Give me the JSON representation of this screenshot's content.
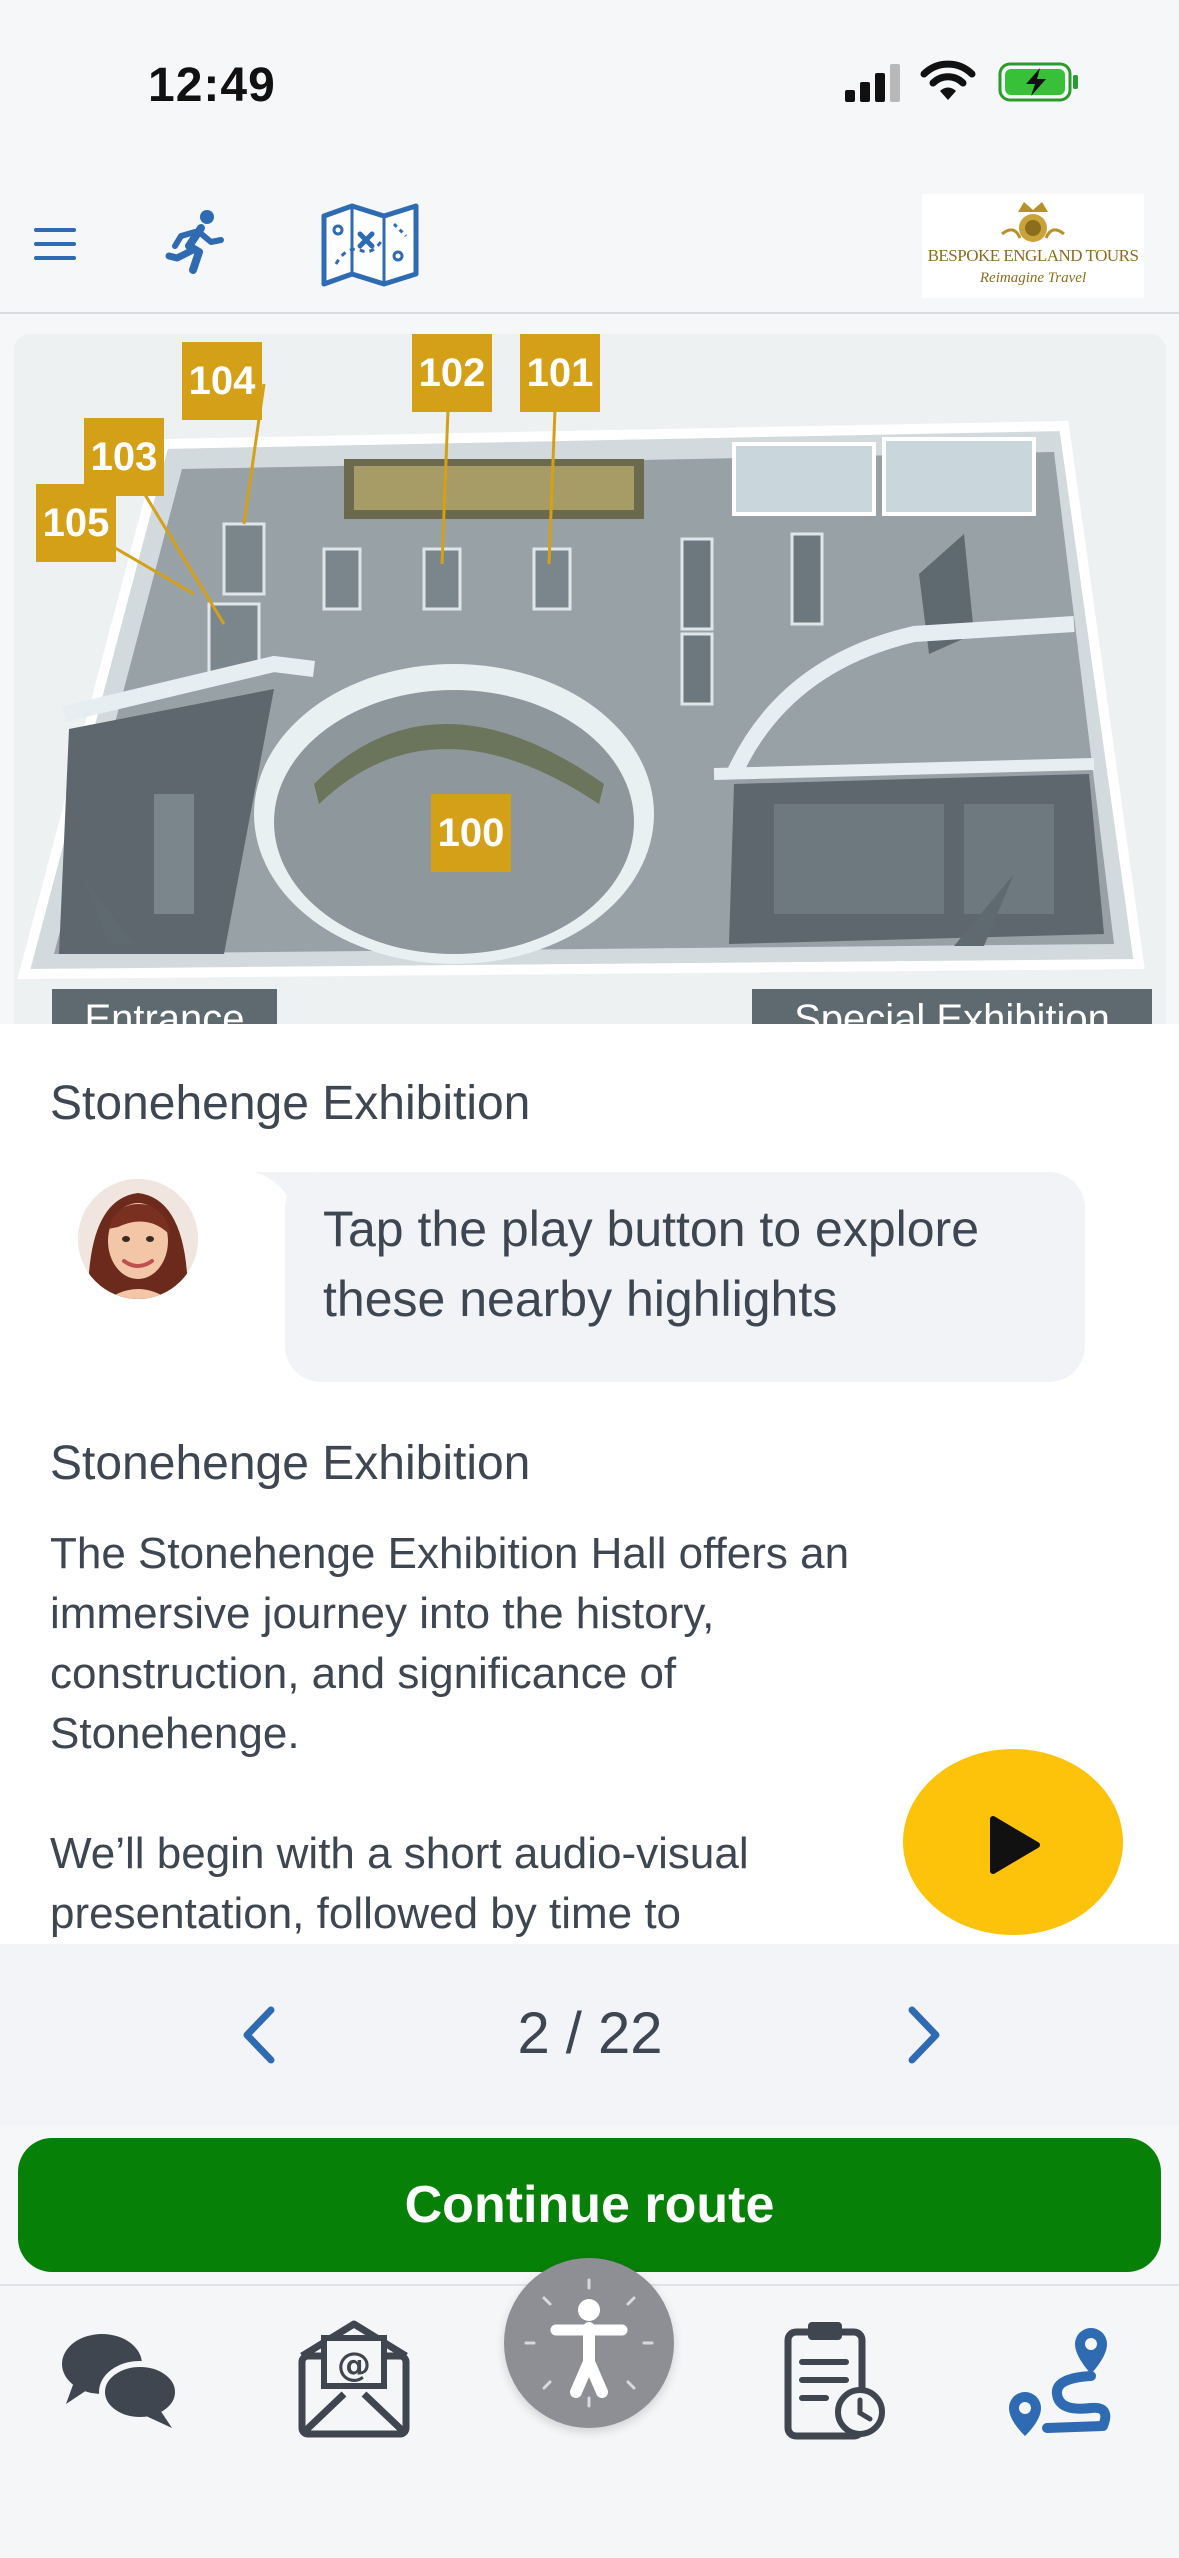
{
  "status_bar": {
    "time": "12:49"
  },
  "header": {
    "menu_icon": "hamburger-menu-icon",
    "activity_icon": "running-person-icon",
    "map_icon": "treasure-map-icon",
    "logo": {
      "line1": "BESPOKE ENGLAND TOURS",
      "line2": "Reimagine Travel"
    }
  },
  "floor_plan": {
    "labels": [
      "104",
      "102",
      "101",
      "103",
      "105",
      "100"
    ],
    "entrance": "Entrance",
    "special": "Special Exhibition"
  },
  "content": {
    "title": "Stonehenge Exhibition",
    "guide_message": "Tap the play button to explore these nearby highlights",
    "section_title": "Stonehenge Exhibition",
    "section_body": "The Stonehenge Exhibition Hall offers an immersive journey into the history, construction, and significance of Stonehenge.\n\nWe’ll begin with a short audio-visual presentation, followed by time to",
    "play_icon": "play-icon"
  },
  "pager": {
    "indicator": "2 / 22"
  },
  "continue_button": {
    "label": "Continue route"
  },
  "tab_bar": {
    "items": [
      "chat-bubbles-icon",
      "email-envelope-icon",
      "accessibility-person-icon",
      "clipboard-clock-icon",
      "route-icon"
    ]
  },
  "colors": {
    "accent_blue": "#2e6bb3",
    "play_yellow": "#fdc30a",
    "continue_green": "#078007",
    "label_gold": "#d4a017"
  }
}
